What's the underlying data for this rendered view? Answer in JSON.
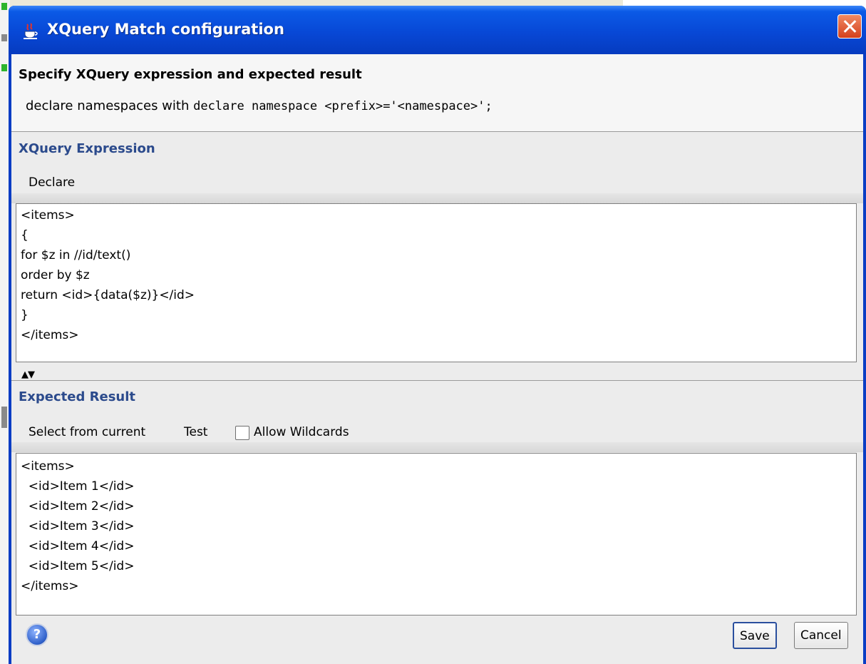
{
  "window": {
    "title": "XQuery Match configuration"
  },
  "header": {
    "title": "Specify XQuery expression and expected result",
    "note_prefix": "declare namespaces with ",
    "note_code": "declare namespace <prefix>='<namespace>';"
  },
  "xquery_section": {
    "title": "XQuery Expression",
    "declare_label": "Declare",
    "expression": "<items>\n{\nfor $z in //id/text()\norder by $z\nreturn <id>{data($z)}</id>\n}\n</items>"
  },
  "splitter": {
    "up_glyph": "▲",
    "down_glyph": "▼"
  },
  "expected_section": {
    "title": "Expected Result",
    "select_label": "Select from current",
    "test_label": "Test",
    "allow_wildcards_label": "Allow Wildcards",
    "allow_wildcards_checked": false,
    "result": "<items>\n  <id>Item 1</id>\n  <id>Item 2</id>\n  <id>Item 3</id>\n  <id>Item 4</id>\n  <id>Item 5</id>\n</items>"
  },
  "footer": {
    "help_glyph": "?",
    "save_label": "Save",
    "cancel_label": "Cancel"
  },
  "colors": {
    "titlebar": "#0848d6",
    "section_title": "#2b4a8c",
    "close_button": "#d4401c"
  }
}
